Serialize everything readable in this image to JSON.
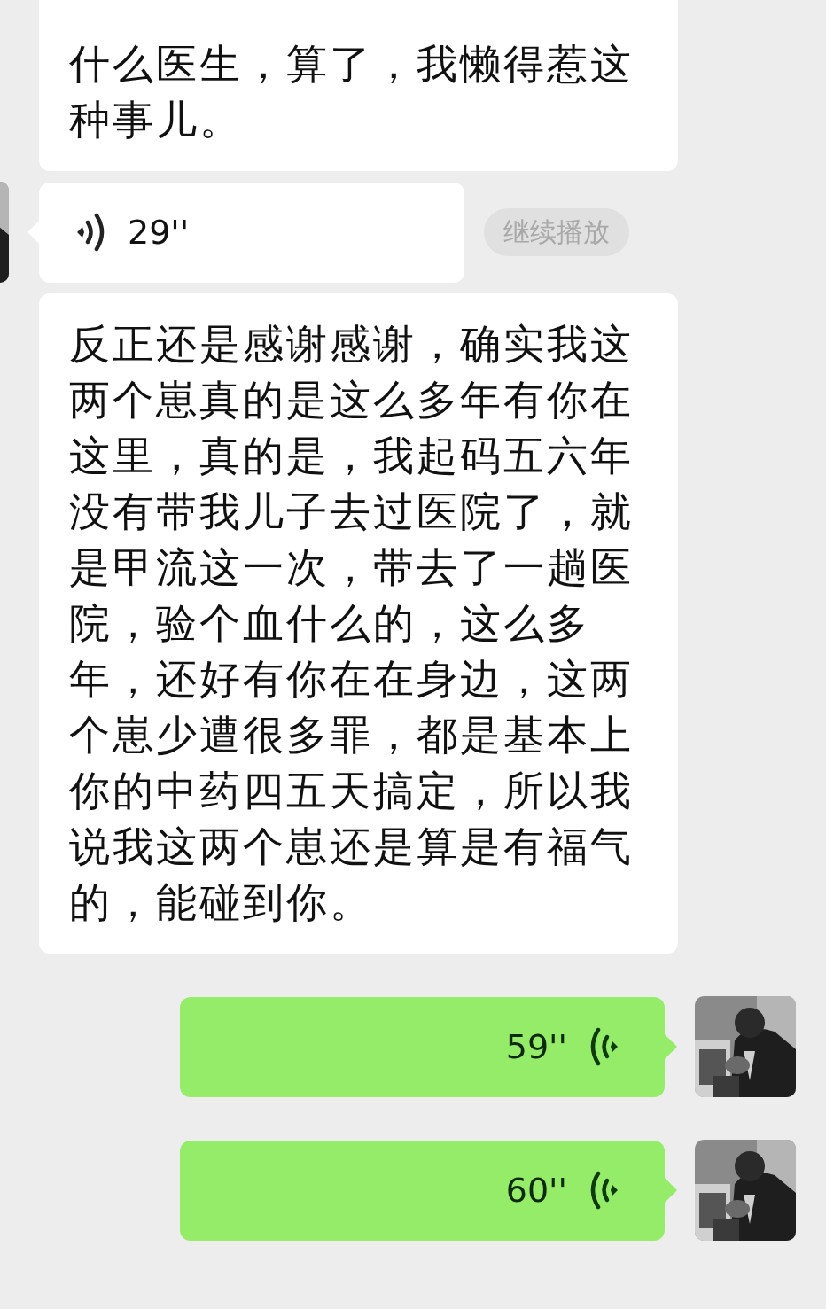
{
  "messages": [
    {
      "kind": "text",
      "outgoing": false,
      "text": "什么医生，算了，我懒得惹这种事儿。"
    },
    {
      "kind": "voice",
      "outgoing": false,
      "avatar": true,
      "duration": "29''",
      "action": "继续播放"
    },
    {
      "kind": "text",
      "outgoing": false,
      "text": "反正还是感谢感谢，确实我这两个崽真的是这么多年有你在这里，真的是，我起码五六年没有带我儿子去过医院了，就是甲流这一次，带去了一趟医院，验个血什么的，这么多年，还好有你在在身边，这两个崽少遭很多罪，都是基本上你的中药四五天搞定，所以我说我这两个崽还是算是有福气的，能碰到你。"
    },
    {
      "kind": "voice",
      "outgoing": true,
      "avatar": true,
      "duration": "59''"
    },
    {
      "kind": "voice",
      "outgoing": true,
      "avatar": true,
      "duration": "60''"
    }
  ]
}
